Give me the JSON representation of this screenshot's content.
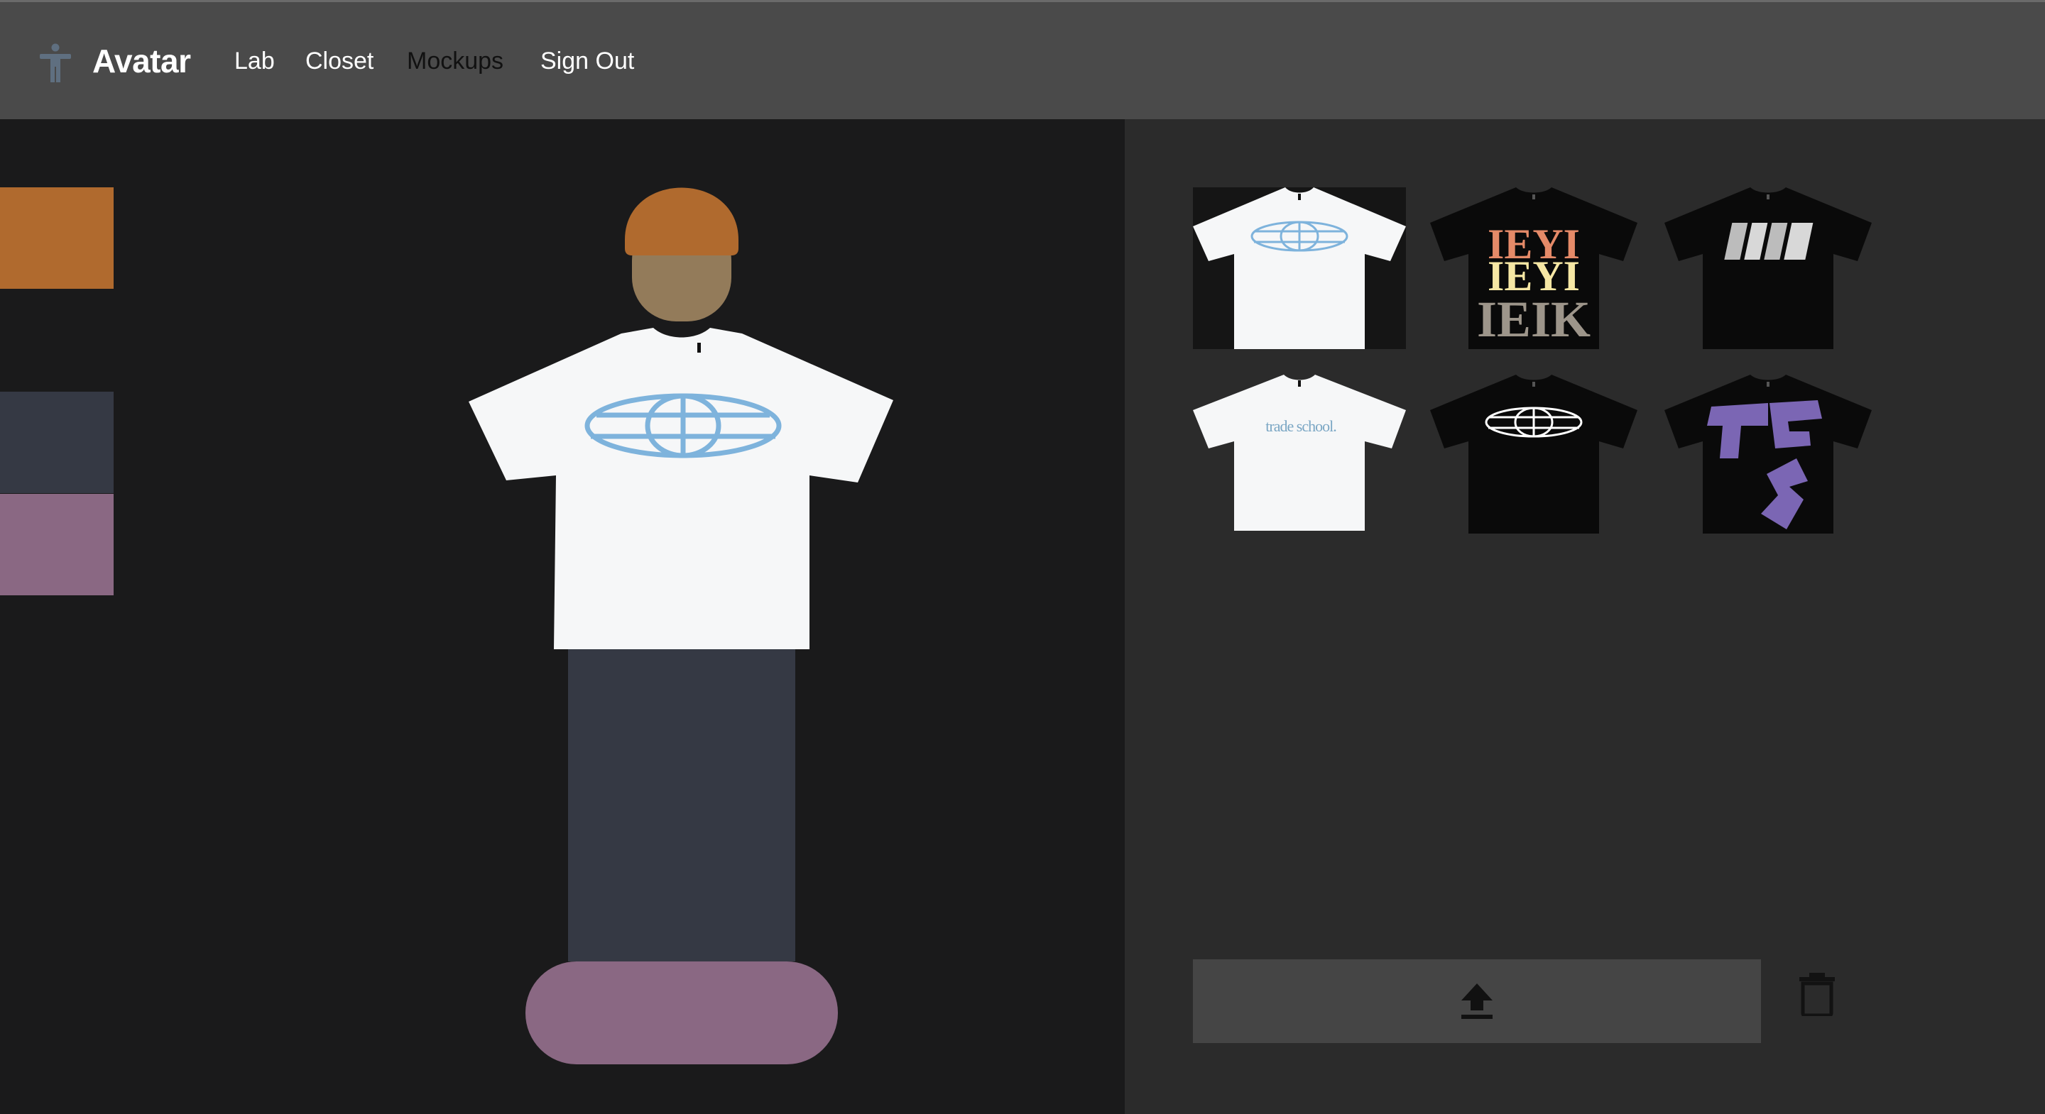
{
  "header": {
    "title": "Avatar",
    "nav": [
      {
        "label": "Lab"
      },
      {
        "label": "Closet"
      },
      {
        "label": "Mockups"
      },
      {
        "label": "Sign Out"
      }
    ]
  },
  "palette": {
    "hat": "#b06a2e",
    "pants": "#353944",
    "shoes": "#8a6883",
    "skin": "#937b5a",
    "shirt": "#f6f7f8",
    "shirt_print": "#7eb3dc"
  },
  "closet": {
    "items": [
      {
        "shirt_color": "white",
        "design": "globe"
      },
      {
        "shirt_color": "black",
        "design": "stacked letters"
      },
      {
        "shirt_color": "black",
        "design": "chrome letters"
      },
      {
        "shirt_color": "white",
        "design": "trade school",
        "print_text": "trade school."
      },
      {
        "shirt_color": "black",
        "design": "globe outline"
      },
      {
        "shirt_color": "black",
        "design": "purple letters"
      }
    ]
  },
  "actions": {
    "upload_icon": "upload-icon",
    "delete_icon": "trash-icon"
  }
}
